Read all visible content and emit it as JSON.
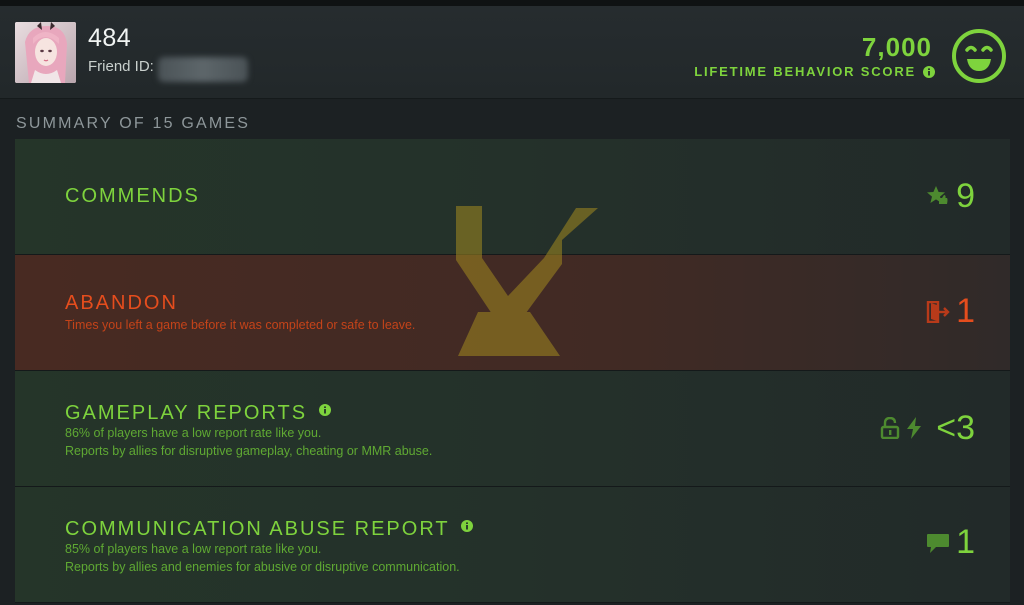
{
  "player": {
    "name": "484",
    "friend_id_label": "Friend ID:"
  },
  "behavior": {
    "score": "7,000",
    "label": "LIFETIME BEHAVIOR SCORE",
    "face": "smiley-face-icon"
  },
  "summary": {
    "title": "SUMMARY OF 15 GAMES"
  },
  "rows": {
    "commends": {
      "title": "COMMENDS",
      "value": "9",
      "icon": "star-thumb-icon"
    },
    "abandon": {
      "title": "ABANDON",
      "desc": "Times you left a game before it was completed or safe to leave.",
      "value": "1",
      "icon": "exit-door-icon"
    },
    "gameplay": {
      "title": "GAMEPLAY REPORTS",
      "desc1": "86% of players have a low report rate like you.",
      "desc2": "Reports by allies for disruptive gameplay, cheating or MMR abuse.",
      "value": "<3",
      "icons": [
        "lock-icon",
        "lightning-icon"
      ]
    },
    "communication": {
      "title": "COMMUNICATION ABUSE REPORT",
      "desc1": "85% of players have a low report rate like you.",
      "desc2": "Reports by allies and enemies for abusive or disruptive communication.",
      "value": "1",
      "icon": "chat-bubble-icon"
    }
  },
  "colors": {
    "good": "#7ed33d",
    "bad": "#e54d1d",
    "background": "#1c2123"
  }
}
